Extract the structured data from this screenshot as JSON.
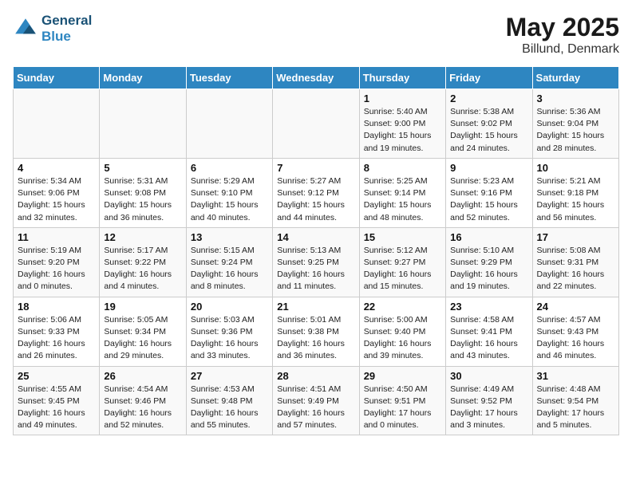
{
  "header": {
    "logo_line1": "General",
    "logo_line2": "Blue",
    "title": "May 2025",
    "subtitle": "Billund, Denmark"
  },
  "weekdays": [
    "Sunday",
    "Monday",
    "Tuesday",
    "Wednesday",
    "Thursday",
    "Friday",
    "Saturday"
  ],
  "weeks": [
    [
      {
        "day": "",
        "info": ""
      },
      {
        "day": "",
        "info": ""
      },
      {
        "day": "",
        "info": ""
      },
      {
        "day": "",
        "info": ""
      },
      {
        "day": "1",
        "info": "Sunrise: 5:40 AM\nSunset: 9:00 PM\nDaylight: 15 hours\nand 19 minutes."
      },
      {
        "day": "2",
        "info": "Sunrise: 5:38 AM\nSunset: 9:02 PM\nDaylight: 15 hours\nand 24 minutes."
      },
      {
        "day": "3",
        "info": "Sunrise: 5:36 AM\nSunset: 9:04 PM\nDaylight: 15 hours\nand 28 minutes."
      }
    ],
    [
      {
        "day": "4",
        "info": "Sunrise: 5:34 AM\nSunset: 9:06 PM\nDaylight: 15 hours\nand 32 minutes."
      },
      {
        "day": "5",
        "info": "Sunrise: 5:31 AM\nSunset: 9:08 PM\nDaylight: 15 hours\nand 36 minutes."
      },
      {
        "day": "6",
        "info": "Sunrise: 5:29 AM\nSunset: 9:10 PM\nDaylight: 15 hours\nand 40 minutes."
      },
      {
        "day": "7",
        "info": "Sunrise: 5:27 AM\nSunset: 9:12 PM\nDaylight: 15 hours\nand 44 minutes."
      },
      {
        "day": "8",
        "info": "Sunrise: 5:25 AM\nSunset: 9:14 PM\nDaylight: 15 hours\nand 48 minutes."
      },
      {
        "day": "9",
        "info": "Sunrise: 5:23 AM\nSunset: 9:16 PM\nDaylight: 15 hours\nand 52 minutes."
      },
      {
        "day": "10",
        "info": "Sunrise: 5:21 AM\nSunset: 9:18 PM\nDaylight: 15 hours\nand 56 minutes."
      }
    ],
    [
      {
        "day": "11",
        "info": "Sunrise: 5:19 AM\nSunset: 9:20 PM\nDaylight: 16 hours\nand 0 minutes."
      },
      {
        "day": "12",
        "info": "Sunrise: 5:17 AM\nSunset: 9:22 PM\nDaylight: 16 hours\nand 4 minutes."
      },
      {
        "day": "13",
        "info": "Sunrise: 5:15 AM\nSunset: 9:24 PM\nDaylight: 16 hours\nand 8 minutes."
      },
      {
        "day": "14",
        "info": "Sunrise: 5:13 AM\nSunset: 9:25 PM\nDaylight: 16 hours\nand 11 minutes."
      },
      {
        "day": "15",
        "info": "Sunrise: 5:12 AM\nSunset: 9:27 PM\nDaylight: 16 hours\nand 15 minutes."
      },
      {
        "day": "16",
        "info": "Sunrise: 5:10 AM\nSunset: 9:29 PM\nDaylight: 16 hours\nand 19 minutes."
      },
      {
        "day": "17",
        "info": "Sunrise: 5:08 AM\nSunset: 9:31 PM\nDaylight: 16 hours\nand 22 minutes."
      }
    ],
    [
      {
        "day": "18",
        "info": "Sunrise: 5:06 AM\nSunset: 9:33 PM\nDaylight: 16 hours\nand 26 minutes."
      },
      {
        "day": "19",
        "info": "Sunrise: 5:05 AM\nSunset: 9:34 PM\nDaylight: 16 hours\nand 29 minutes."
      },
      {
        "day": "20",
        "info": "Sunrise: 5:03 AM\nSunset: 9:36 PM\nDaylight: 16 hours\nand 33 minutes."
      },
      {
        "day": "21",
        "info": "Sunrise: 5:01 AM\nSunset: 9:38 PM\nDaylight: 16 hours\nand 36 minutes."
      },
      {
        "day": "22",
        "info": "Sunrise: 5:00 AM\nSunset: 9:40 PM\nDaylight: 16 hours\nand 39 minutes."
      },
      {
        "day": "23",
        "info": "Sunrise: 4:58 AM\nSunset: 9:41 PM\nDaylight: 16 hours\nand 43 minutes."
      },
      {
        "day": "24",
        "info": "Sunrise: 4:57 AM\nSunset: 9:43 PM\nDaylight: 16 hours\nand 46 minutes."
      }
    ],
    [
      {
        "day": "25",
        "info": "Sunrise: 4:55 AM\nSunset: 9:45 PM\nDaylight: 16 hours\nand 49 minutes."
      },
      {
        "day": "26",
        "info": "Sunrise: 4:54 AM\nSunset: 9:46 PM\nDaylight: 16 hours\nand 52 minutes."
      },
      {
        "day": "27",
        "info": "Sunrise: 4:53 AM\nSunset: 9:48 PM\nDaylight: 16 hours\nand 55 minutes."
      },
      {
        "day": "28",
        "info": "Sunrise: 4:51 AM\nSunset: 9:49 PM\nDaylight: 16 hours\nand 57 minutes."
      },
      {
        "day": "29",
        "info": "Sunrise: 4:50 AM\nSunset: 9:51 PM\nDaylight: 17 hours\nand 0 minutes."
      },
      {
        "day": "30",
        "info": "Sunrise: 4:49 AM\nSunset: 9:52 PM\nDaylight: 17 hours\nand 3 minutes."
      },
      {
        "day": "31",
        "info": "Sunrise: 4:48 AM\nSunset: 9:54 PM\nDaylight: 17 hours\nand 5 minutes."
      }
    ]
  ]
}
